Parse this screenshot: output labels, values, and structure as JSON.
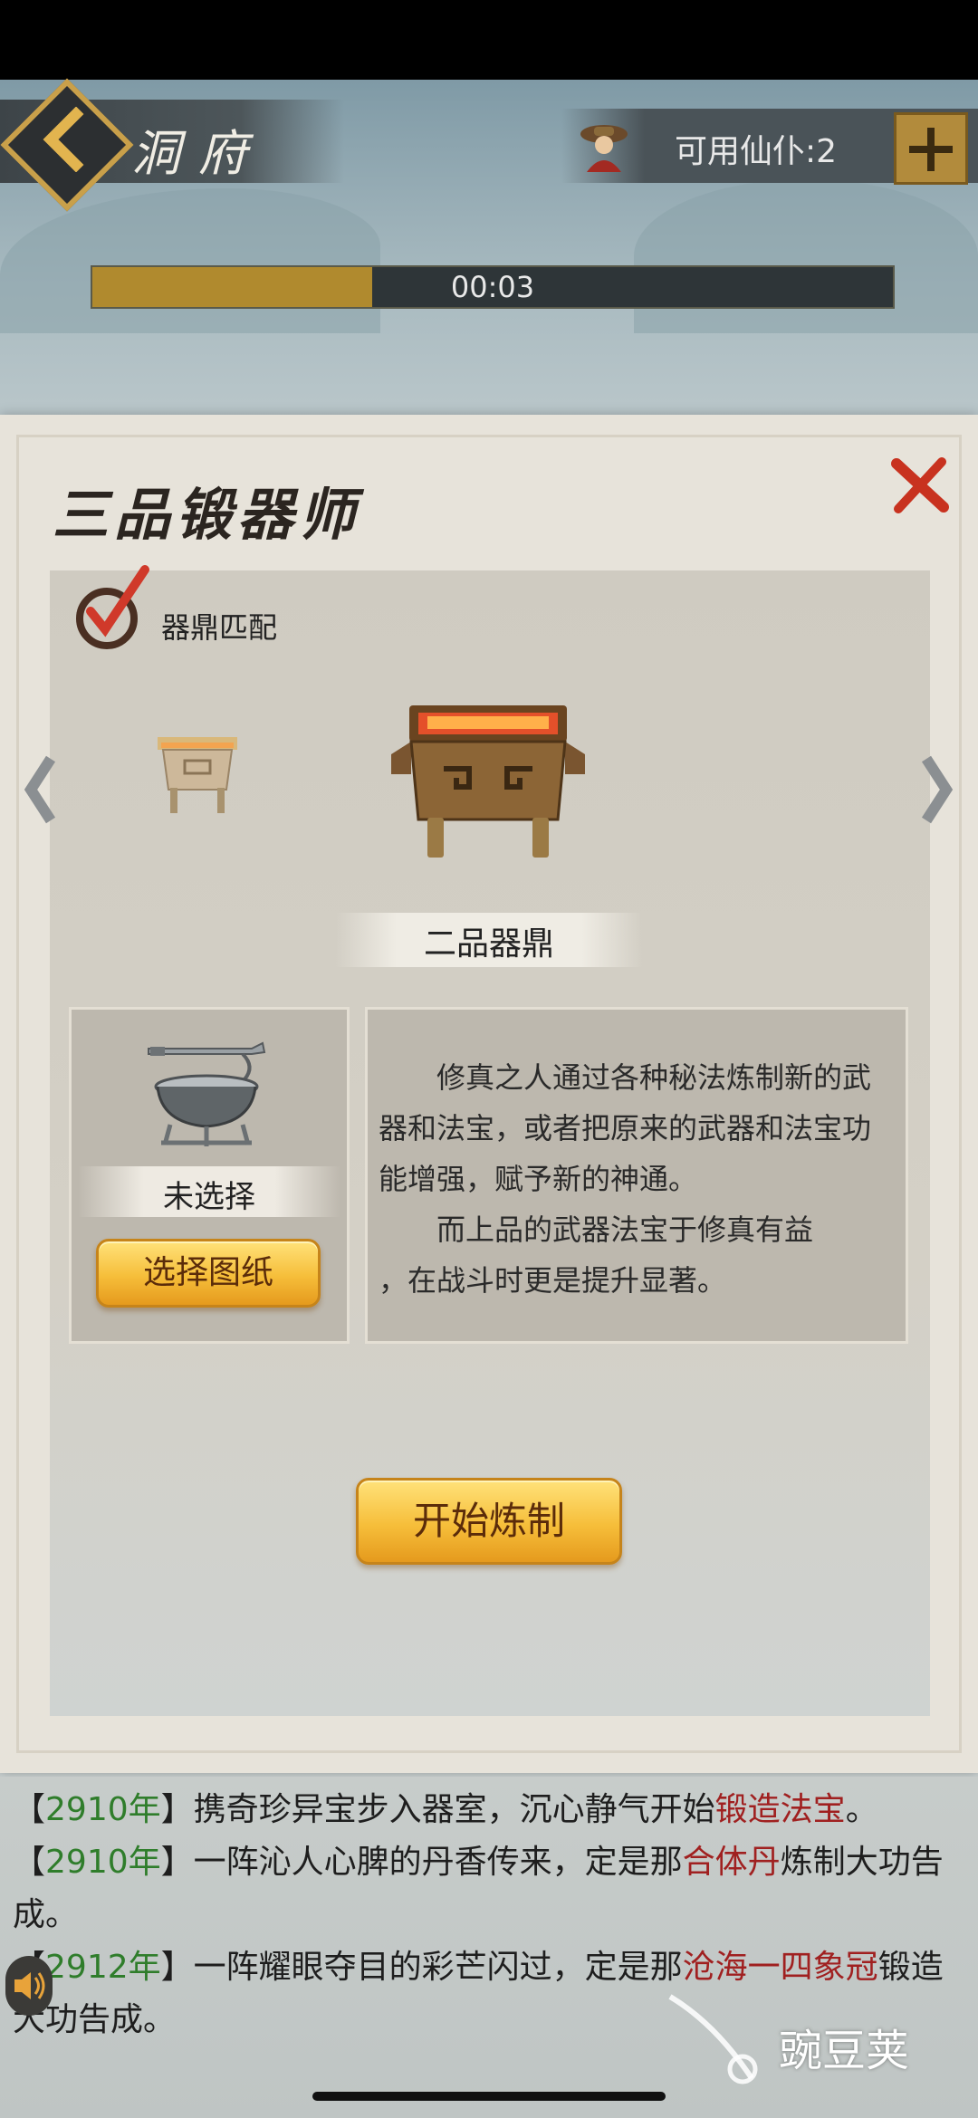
{
  "header": {
    "title": "洞府",
    "servant_label": "可用仙仆:2"
  },
  "progress": {
    "fraction": 0.35,
    "time": "00:03",
    "fill_color": "#b08a2e"
  },
  "dialog": {
    "title": "三品锻器师",
    "match_label": "器鼎匹配",
    "tripod_name": "二品器鼎",
    "blueprint_status": "未选择",
    "select_button": "选择图纸",
    "description_p1": "修真之人通过各种秘法炼制新的武器和法宝，或者把原来的武器和法宝功能增强，赋予新的神通。",
    "description_p2a": "而上品的武器法宝于修真有益",
    "description_p2b": "，在战斗时更是提升显著。",
    "start_button": "开始炼制"
  },
  "log": [
    {
      "open": "【",
      "year": "2910年",
      "close": "】",
      "text": "携奇珍异宝步入器室，沉心静气开始",
      "highlight": "锻造法宝",
      "tail": "。"
    },
    {
      "open": "【",
      "year": "2910年",
      "close": "】",
      "text": "一阵沁人心脾的丹香传来，定是那",
      "highlight": "合体丹",
      "tail": "炼制大功告成。"
    },
    {
      "open": "【",
      "year": "2912年",
      "close": "】",
      "text": "一阵耀眼夺目的彩芒闪过，定是那",
      "highlight": "沧海一四象冠",
      "tail": "锻造大功告成。"
    }
  ],
  "watermark": "豌豆荚",
  "icons": {
    "back": "back-chevron-icon",
    "servant": "servant-avatar-icon",
    "plus": "plus-icon",
    "close": "close-x-icon",
    "match": "checkmark-icon",
    "sound": "speaker-icon"
  }
}
